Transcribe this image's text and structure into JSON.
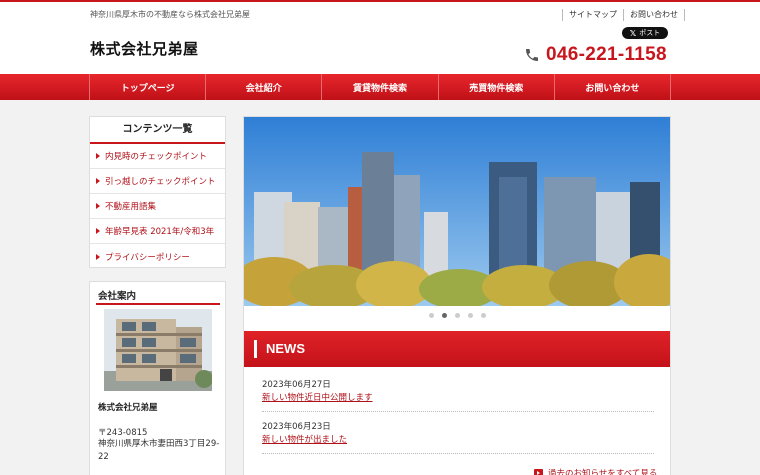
{
  "header": {
    "tagline": "神奈川県厚木市の不動産なら株式会社兄弟屋",
    "site_name": "株式会社兄弟屋",
    "links": [
      "サイトマップ",
      "お問い合わせ"
    ],
    "x_post_label": "ポスト",
    "phone": "046-221-1158",
    "icons": {
      "phone": "phone-icon",
      "x": "x-logo-icon"
    }
  },
  "nav": [
    "トップページ",
    "会社紹介",
    "賃貸物件検索",
    "売買物件検索",
    "お問い合わせ"
  ],
  "sidebar": {
    "contents_title": "コンテンツ一覧",
    "items": [
      "内見時のチェックポイント",
      "引っ越しのチェックポイント",
      "不動産用語集",
      "年齢早見表 2021年/令和3年",
      "プライバシーポリシー"
    ],
    "company": {
      "title": "会社案内",
      "name": "株式会社兄弟屋",
      "zip": "〒243-0815",
      "address": "神奈川県厚木市妻田西3丁目29-22"
    }
  },
  "slider": {
    "slide_count": 5,
    "active_slide": 2
  },
  "news": {
    "title": "NEWS",
    "items": [
      {
        "date": "2023年06月27日",
        "text": "新しい物件近日中公開します"
      },
      {
        "date": "2023年06月23日",
        "text": "新しい物件が出ました"
      }
    ],
    "more_label": "過去のお知らせをすべて見る"
  },
  "colors": {
    "accent": "#c8161d",
    "link": "#b01018"
  }
}
